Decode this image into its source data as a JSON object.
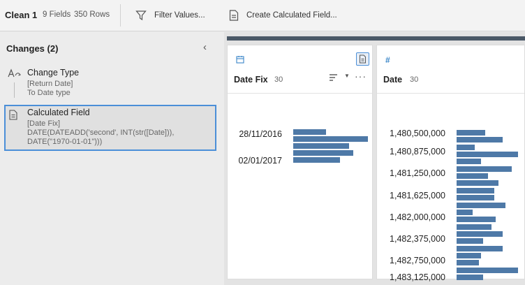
{
  "toolbar": {
    "title": "Clean 1",
    "fields": "9 Fields",
    "rows": "350 Rows",
    "filter_label": "Filter Values...",
    "calc_label": "Create Calculated Field..."
  },
  "changes": {
    "title": "Changes (2)",
    "items": [
      {
        "title": "Change Type",
        "lines": [
          "[Return Date]",
          "To Date type"
        ]
      },
      {
        "title": "Calculated Field",
        "lines": [
          "[Date Fix]",
          "DATE(DATEADD('second', INT(str([Date])),",
          "DATE(\"1970-01-01\")))"
        ]
      }
    ]
  },
  "cards": [
    {
      "name": "Date Fix",
      "count": "30",
      "icon": "calendar-icon",
      "axis_labels": [
        "28/11/2016",
        "02/01/2017"
      ],
      "bar_values": [
        0.44,
        1.0,
        0.75,
        0.8,
        0.63
      ]
    },
    {
      "name": "Date",
      "count": "30",
      "icon": "hash-icon",
      "axis_labels": [
        "1,480,500,000",
        "1,480,875,000",
        "1,481,250,000",
        "1,481,625,000",
        "1,482,000,000",
        "1,482,375,000",
        "1,482,750,000",
        "1,483,125,000"
      ],
      "bar_values": [
        0.47,
        0.75,
        0.29,
        1.0,
        0.4,
        0.9,
        0.51,
        0.68,
        0.61,
        0.61,
        0.79,
        0.26,
        0.64,
        0.57,
        0.75,
        0.43,
        0.75,
        0.4,
        0.36,
        1.0,
        0.43
      ]
    }
  ]
}
